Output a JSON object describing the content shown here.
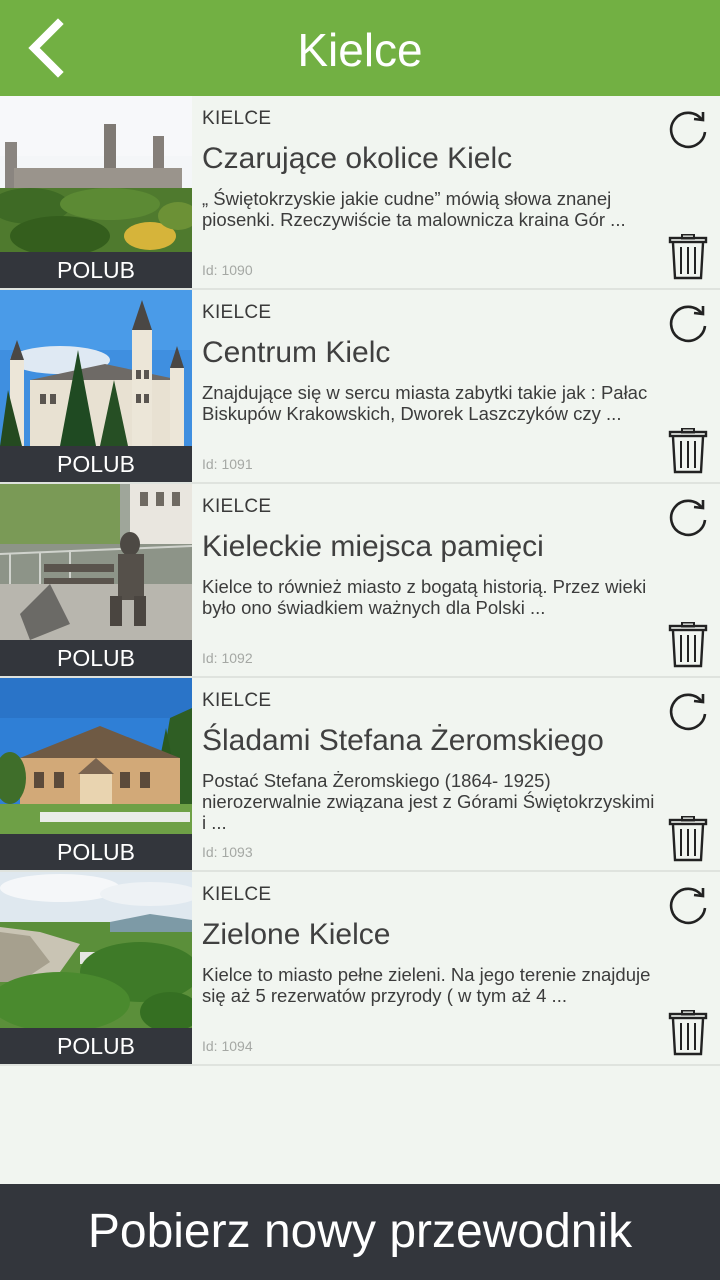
{
  "header": {
    "title": "Kielce",
    "back_icon": "chevron-left-icon"
  },
  "colors": {
    "accent": "#72b043",
    "dark_bar": "#33363c",
    "background": "#f1f5f0"
  },
  "items": [
    {
      "like_label": "POLUB",
      "city": "KIELCE",
      "title": "Czarujące okolice Kielc",
      "description": "„ Świętokrzyskie jakie cudne” mówią słowa znanej piosenki. Rzeczywiście ta malownicza kraina Gór ...",
      "id_label": "Id: 1090"
    },
    {
      "like_label": "POLUB",
      "city": "KIELCE",
      "title": "Centrum Kielc",
      "description": "Znajdujące się w sercu miasta zabytki takie jak : Pałac Biskupów Krakowskich, Dworek Laszczyków czy ...",
      "id_label": "Id: 1091"
    },
    {
      "like_label": "POLUB",
      "city": "KIELCE",
      "title": "Kieleckie miejsca pamięci",
      "description": "Kielce to również miasto z bogatą historią. Przez wieki było ono świadkiem ważnych dla Polski ...",
      "id_label": "Id: 1092"
    },
    {
      "like_label": "POLUB",
      "city": "KIELCE",
      "title": "Śladami Stefana Żeromskiego",
      "description": "Postać Stefana Żeromskiego (1864- 1925) nierozerwalnie związana jest z Górami Świętokrzyskimi i ...",
      "id_label": "Id: 1093"
    },
    {
      "like_label": "POLUB",
      "city": "KIELCE",
      "title": "Zielone Kielce",
      "description": "Kielce to miasto pełne zieleni. Na jego terenie znajduje się aż 5 rezerwatów przyrody ( w tym aż 4 ...",
      "id_label": "Id: 1094"
    }
  ],
  "footer": {
    "label": "Pobierz nowy przewodnik"
  }
}
